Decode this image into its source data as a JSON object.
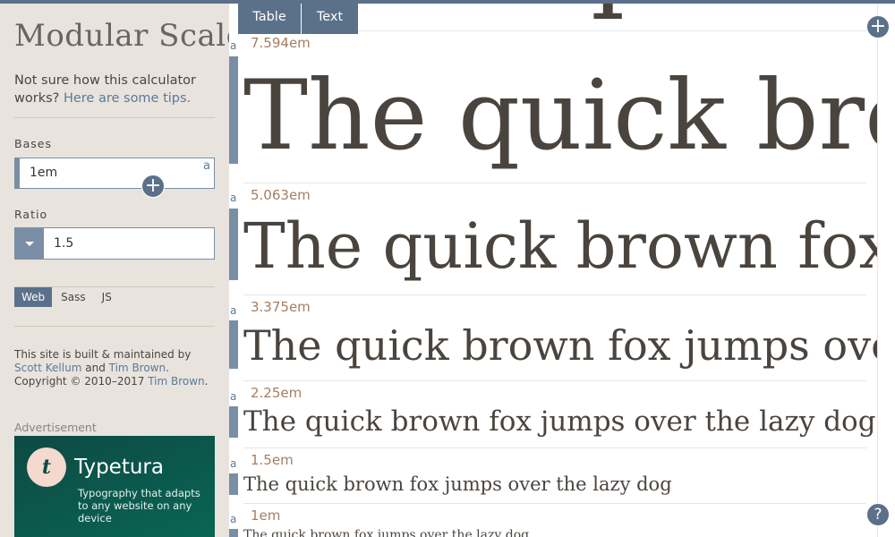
{
  "sidebar": {
    "title": "Modular Scale",
    "intro_text": "Not sure how this calculator works?",
    "intro_link": "Here are some tips.",
    "bases_label": "Bases",
    "base_value": "1em",
    "base_mark": "a",
    "ratio_label": "Ratio",
    "ratio_value": "1.5",
    "output_tabs": [
      "Web",
      "Sass",
      "JS"
    ],
    "credits": {
      "pre": "This site is built & maintained by",
      "author1": "Scott Kellum",
      "and": "and",
      "author2": "Tim Brown",
      "post": ". Copyright ©",
      "years": "2010–2017",
      "author3": "Tim Brown",
      "end": "."
    },
    "ad_label": "Advertisement",
    "ad": {
      "logo_letter": "t",
      "brand": "Typetura",
      "tagline": "Typography that adapts to any website on any device"
    }
  },
  "main": {
    "tabs": [
      "Table",
      "Text"
    ],
    "specimen_text": "The quick brown fox jumps over the lazy dog",
    "row_mark": "a",
    "rows": [
      {
        "size": "7.594em"
      },
      {
        "size": "5.063em"
      },
      {
        "size": "3.375em"
      },
      {
        "size": "2.25em"
      },
      {
        "size": "1.5em"
      },
      {
        "size": "1em"
      }
    ],
    "help_icon": "?"
  },
  "colors": {
    "accent": "#5b7089",
    "sidebar_bg": "#e8e3dd",
    "size_label": "#a57e60",
    "specimen": "#4a443f"
  }
}
